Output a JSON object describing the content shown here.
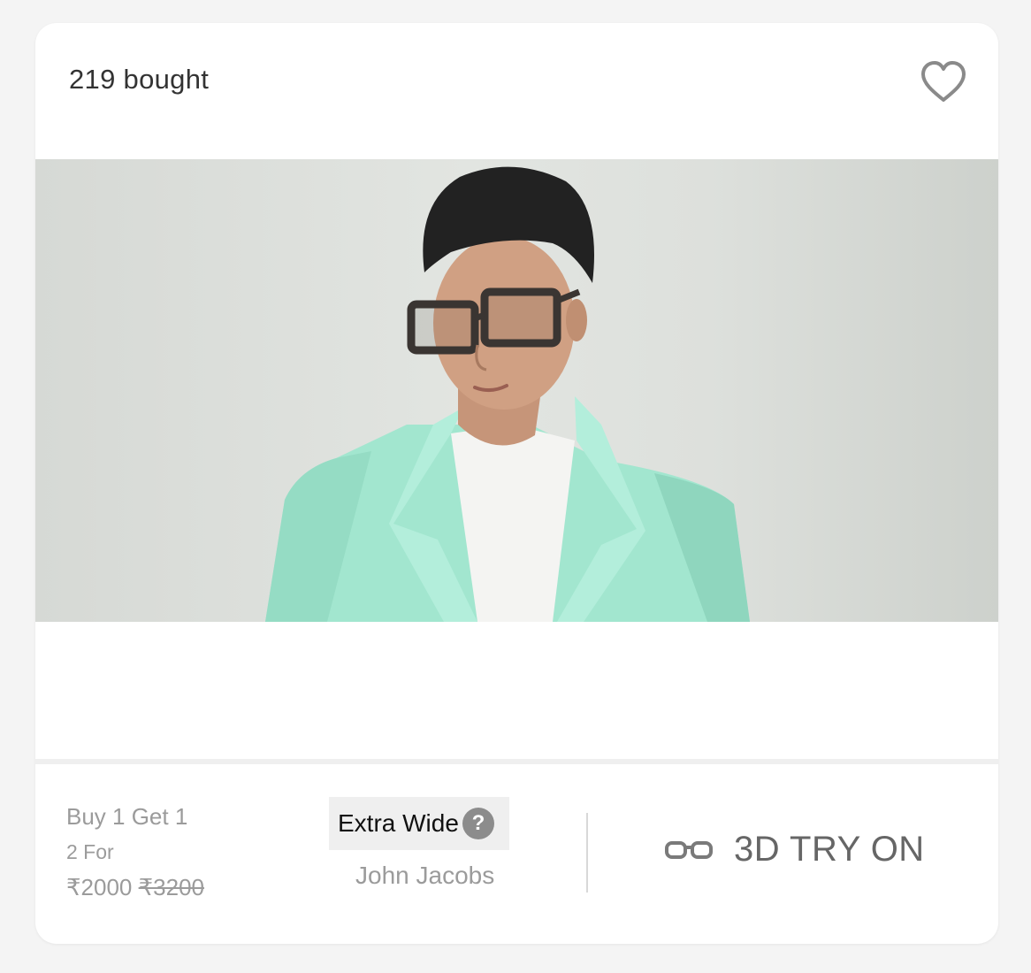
{
  "card": {
    "bought": "219 bought",
    "wishlist_icon": "heart-outline-icon",
    "image_alt": "Model wearing oversized square eyeglasses and a mint green blazer",
    "offer": {
      "line1": "Buy 1 Get 1",
      "line2": "2 For",
      "price": "₹2000",
      "original_price": "₹3200"
    },
    "frame_width": {
      "label": "Extra Wide",
      "help_glyph": "?"
    },
    "brand": "John Jacobs",
    "try_on": {
      "icon": "glasses-icon",
      "label": "3D TRY ON"
    }
  },
  "colors": {
    "background": "#f4f4f4",
    "card": "#ffffff",
    "muted_text": "#9b9b9b",
    "blazer": "#9fe3cd"
  }
}
